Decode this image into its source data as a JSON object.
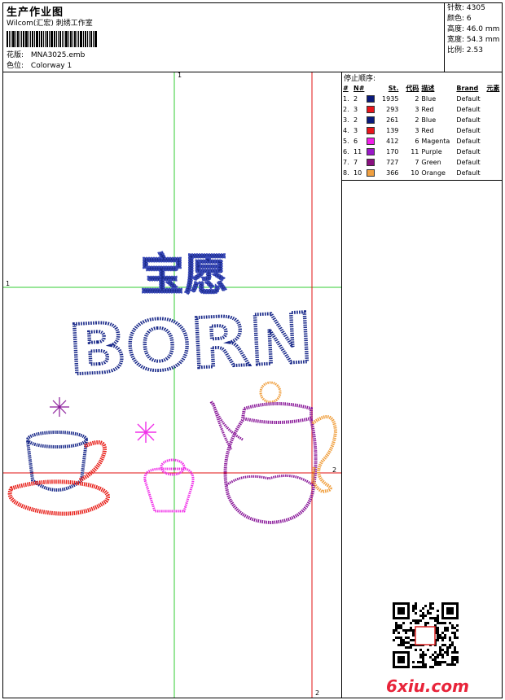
{
  "header": {
    "title": "生产作业图",
    "company": "Wilcom(汇宏) 刺绣工作室",
    "design_label": "花版:",
    "design_file": "MNA3025.emb",
    "colorway_label": "色位:",
    "colorway": "Colorway 1"
  },
  "stats": [
    {
      "label": "针数:",
      "value": "4305"
    },
    {
      "label": "颜色:",
      "value": "6"
    },
    {
      "label": "高度:",
      "value": "46.0 mm"
    },
    {
      "label": "宽度:",
      "value": "54.3 mm"
    },
    {
      "label": "比例:",
      "value": "2.53"
    }
  ],
  "stops": {
    "title": "停止顺序:",
    "columns": [
      "#",
      "N#",
      "St.",
      "代码",
      "描述",
      "Brand",
      "元素"
    ],
    "rows": [
      {
        "idx": "1.",
        "n": "2",
        "color": "#0a1a7a",
        "st": "1935",
        "code": "2",
        "desc": "Blue",
        "brand": "Default"
      },
      {
        "idx": "2.",
        "n": "3",
        "color": "#e8151b",
        "st": "293",
        "code": "3",
        "desc": "Red",
        "brand": "Default"
      },
      {
        "idx": "3.",
        "n": "2",
        "color": "#0a1a7a",
        "st": "261",
        "code": "2",
        "desc": "Blue",
        "brand": "Default"
      },
      {
        "idx": "4.",
        "n": "3",
        "color": "#e8151b",
        "st": "139",
        "code": "3",
        "desc": "Red",
        "brand": "Default"
      },
      {
        "idx": "5.",
        "n": "6",
        "color": "#f020e8",
        "st": "412",
        "code": "6",
        "desc": "Magenta",
        "brand": "Default"
      },
      {
        "idx": "6.",
        "n": "11",
        "color": "#9a18c8",
        "st": "170",
        "code": "11",
        "desc": "Purple",
        "brand": "Default"
      },
      {
        "idx": "7.",
        "n": "7",
        "color": "#8a1080",
        "st": "727",
        "code": "7",
        "desc": "Green",
        "brand": "Default"
      },
      {
        "idx": "8.",
        "n": "10",
        "color": "#f0a040",
        "st": "366",
        "code": "10",
        "desc": "Orange",
        "brand": "Default"
      }
    ]
  },
  "design": {
    "top_text": "宝愿",
    "word": "BORN",
    "watermark": "6xiu.com"
  },
  "guides": {
    "v1": "1",
    "h1": "1",
    "v2": "2",
    "h2": "2"
  },
  "colors": {
    "blue": "#1a2a8a",
    "red": "#e8201a",
    "magenta": "#f030e8",
    "purple": "#8a1a9a",
    "orange": "#f0a040",
    "green_guide": "#33cc33",
    "red_guide": "#e01010"
  }
}
